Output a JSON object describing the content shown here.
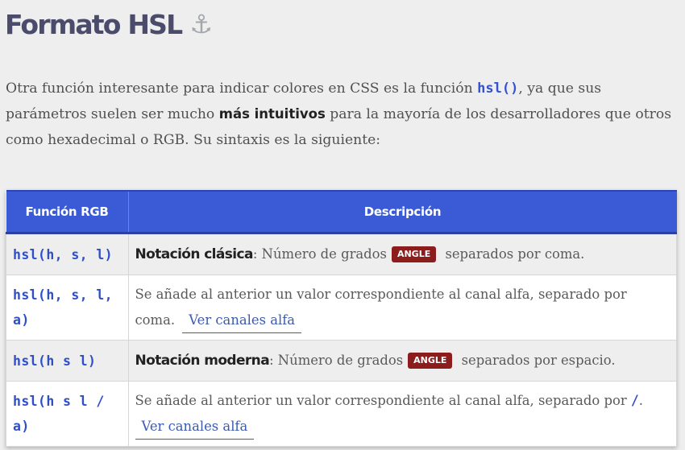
{
  "heading": {
    "text": "Formato HSL",
    "icon": "anchor-icon",
    "icon_glyph": "⚓"
  },
  "intro": {
    "part1": "Otra función interesante para indicar colores en CSS es la función ",
    "code": "hsl()",
    "part2": ", ya que sus parámetros suelen ser mucho ",
    "bold": "más intuitivos",
    "part3": " para la mayoría de los desarrolladores que otros como hexadecimal o RGB. Su sintaxis es la siguiente:"
  },
  "table": {
    "headers": [
      "Función RGB",
      "Descripción"
    ],
    "rows": [
      {
        "fn": "hsl(h, s, l)",
        "bold": "Notación clásica",
        "text1": ": Número de grados",
        "badge": "ANGLE",
        "text2": " separados por coma."
      },
      {
        "fn": "hsl(h, s, l, a)",
        "text1": "Se añade al anterior un valor correspondiente al canal alfa, separado por coma.",
        "link": "Ver canales alfa"
      },
      {
        "fn": "hsl(h s l)",
        "bold": "Notación moderna",
        "text1": ": Número de grados",
        "badge": "ANGLE",
        "text2": " separados por espacio."
      },
      {
        "fn": "hsl(h s l / a)",
        "text1": "Se añade al anterior un valor correspondiente al canal alfa, separado por ",
        "slash": "/",
        "text2": ".",
        "link": "Ver canales alfa"
      }
    ]
  },
  "colors": {
    "heading": "#4b4b6c",
    "header_bg": "#3b5bd6",
    "code": "#2f4fc8",
    "badge": "#8c1d1d",
    "link": "#3a5bb0"
  }
}
